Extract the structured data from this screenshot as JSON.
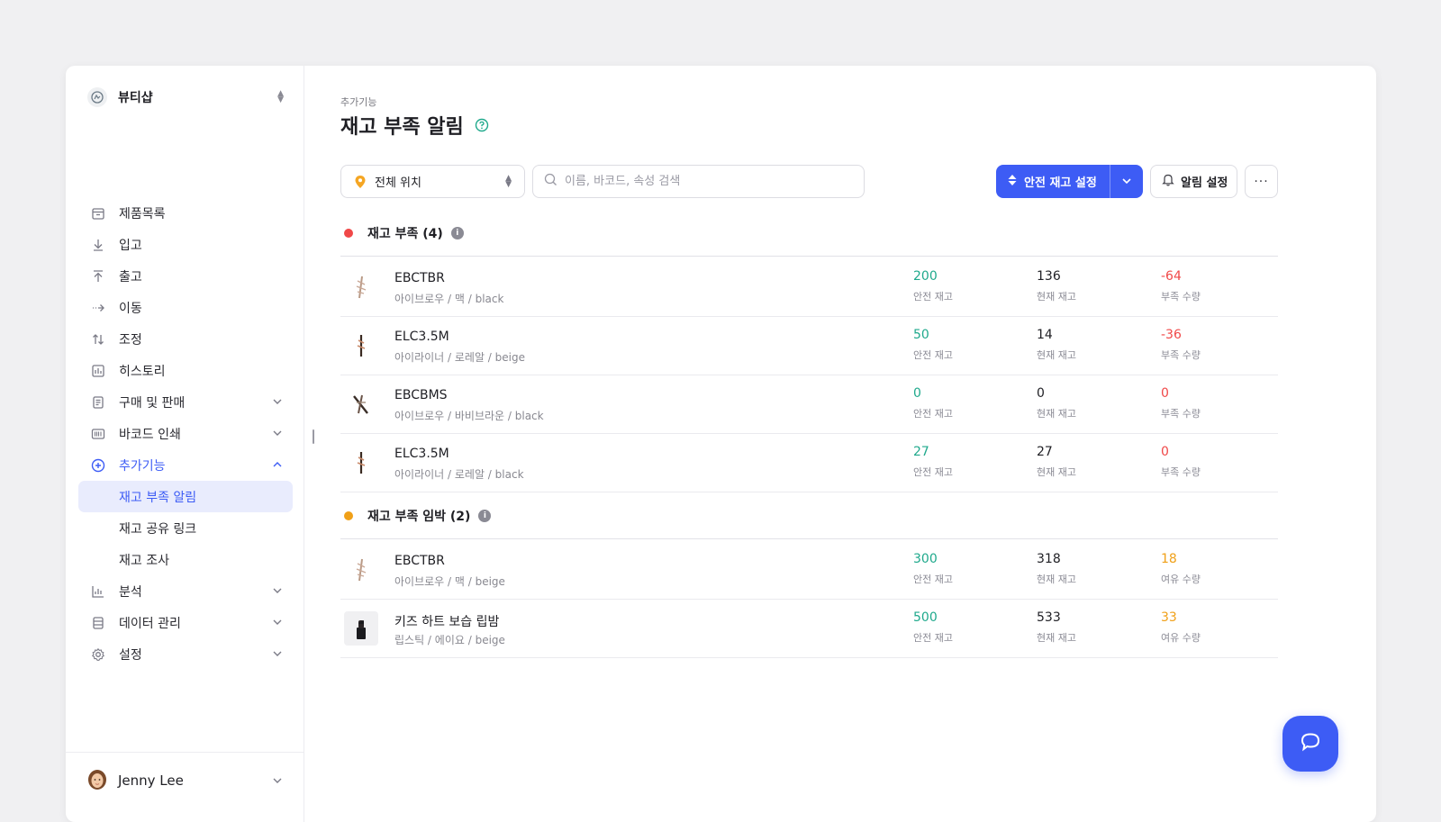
{
  "store": {
    "name": "뷰티샵"
  },
  "sidebar": {
    "items": [
      {
        "label": "제품목록",
        "icon": "box-icon"
      },
      {
        "label": "입고",
        "icon": "arrow-down-icon"
      },
      {
        "label": "출고",
        "icon": "arrow-up-icon"
      },
      {
        "label": "이동",
        "icon": "arrow-right-icon"
      },
      {
        "label": "조정",
        "icon": "swap-vertical-icon"
      },
      {
        "label": "히스토리",
        "icon": "history-icon"
      },
      {
        "label": "구매 및 판매",
        "icon": "document-icon"
      },
      {
        "label": "바코드 인쇄",
        "icon": "barcode-icon"
      },
      {
        "label": "추가기능",
        "icon": "plus-circle-icon"
      },
      {
        "label": "분석",
        "icon": "bar-chart-icon"
      },
      {
        "label": "데이터 관리",
        "icon": "database-icon"
      },
      {
        "label": "설정",
        "icon": "gear-icon"
      }
    ],
    "sub_items": [
      {
        "label": "재고 부족 알림",
        "selected": true
      },
      {
        "label": "재고 공유 링크"
      },
      {
        "label": "재고 조사"
      }
    ],
    "user": {
      "name": "Jenny Lee"
    }
  },
  "page": {
    "breadcrumb": "추가기능",
    "title": "재고 부족 알림"
  },
  "toolbar": {
    "location_label": "전체 위치",
    "search_placeholder": "이름, 바코드, 속성 검색",
    "safety_stock_label": "안전 재고 설정",
    "alarm_settings_label": "알림 설정",
    "more_label": "···"
  },
  "colors": {
    "accent": "#3d5cf5",
    "safety": "#1fa98c",
    "shortage": "#f04848",
    "surplus": "#f0a018"
  },
  "sections": [
    {
      "label": "재고 부족 (4)",
      "dot_color": "#f04848",
      "rows": [
        {
          "name": "EBCTBR",
          "variant": "아이브로우 / 맥 / black",
          "safety": "200",
          "safety_label": "안전 재고",
          "current": "136",
          "current_label": "현재 재고",
          "diff": "-64",
          "diff_label": "부족 수량"
        },
        {
          "name": "ELC3.5M",
          "variant": "아이라이너 / 로레알 / beige",
          "safety": "50",
          "safety_label": "안전 재고",
          "current": "14",
          "current_label": "현재 재고",
          "diff": "-36",
          "diff_label": "부족 수량"
        },
        {
          "name": "EBCBMS",
          "variant": "아이브로우 / 바비브라운 / black",
          "safety": "0",
          "safety_label": "안전 재고",
          "current": "0",
          "current_label": "현재 재고",
          "diff": "0",
          "diff_label": "부족 수량"
        },
        {
          "name": "ELC3.5M",
          "variant": "아이라이너 / 로레알 / black",
          "safety": "27",
          "safety_label": "안전 재고",
          "current": "27",
          "current_label": "현재 재고",
          "diff": "0",
          "diff_label": "부족 수량"
        }
      ]
    },
    {
      "label": "재고 부족 임박 (2)",
      "dot_color": "#f0a018",
      "rows": [
        {
          "name": "EBCTBR",
          "variant": "아이브로우 / 맥 / beige",
          "safety": "300",
          "safety_label": "안전 재고",
          "current": "318",
          "current_label": "현재 재고",
          "diff": "18",
          "diff_label": "여유 수량"
        },
        {
          "name": "키즈 하트 보습 립밤",
          "variant": "립스틱 / 에이요 / beige",
          "safety": "500",
          "safety_label": "안전 재고",
          "current": "533",
          "current_label": "현재 재고",
          "diff": "33",
          "diff_label": "여유 수량"
        }
      ]
    }
  ]
}
